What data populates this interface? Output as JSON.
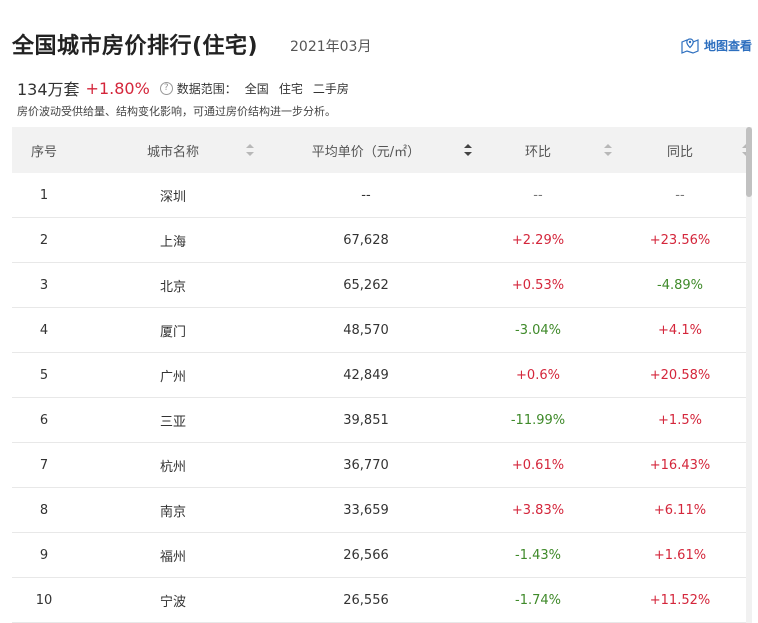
{
  "header": {
    "title": "全国城市房价排行(住宅)",
    "date": "2021年03月",
    "map_link": "地图查看"
  },
  "summary": {
    "count": "134万套",
    "change": "+1.80%",
    "scope_label": "数据范围：",
    "scope_items": [
      "全国",
      "住宅",
      "二手房"
    ],
    "note": "房价波动受供给量、结构变化影响，可通过房价结构进一步分析。"
  },
  "table": {
    "columns": [
      "序号",
      "城市名称",
      "平均单价（元/㎡）",
      "环比",
      "同比"
    ],
    "rows": [
      {
        "rank": "1",
        "city": "深圳",
        "price": "--",
        "mom": "--",
        "mom_dir": "flat",
        "yoy": "--",
        "yoy_dir": "flat"
      },
      {
        "rank": "2",
        "city": "上海",
        "price": "67,628",
        "mom": "+2.29%",
        "mom_dir": "up",
        "yoy": "+23.56%",
        "yoy_dir": "up"
      },
      {
        "rank": "3",
        "city": "北京",
        "price": "65,262",
        "mom": "+0.53%",
        "mom_dir": "up",
        "yoy": "-4.89%",
        "yoy_dir": "down"
      },
      {
        "rank": "4",
        "city": "厦门",
        "price": "48,570",
        "mom": "-3.04%",
        "mom_dir": "down",
        "yoy": "+4.1%",
        "yoy_dir": "up"
      },
      {
        "rank": "5",
        "city": "广州",
        "price": "42,849",
        "mom": "+0.6%",
        "mom_dir": "up",
        "yoy": "+20.58%",
        "yoy_dir": "up"
      },
      {
        "rank": "6",
        "city": "三亚",
        "price": "39,851",
        "mom": "-11.99%",
        "mom_dir": "down",
        "yoy": "+1.5%",
        "yoy_dir": "up"
      },
      {
        "rank": "7",
        "city": "杭州",
        "price": "36,770",
        "mom": "+0.61%",
        "mom_dir": "up",
        "yoy": "+16.43%",
        "yoy_dir": "up"
      },
      {
        "rank": "8",
        "city": "南京",
        "price": "33,659",
        "mom": "+3.83%",
        "mom_dir": "up",
        "yoy": "+6.11%",
        "yoy_dir": "up"
      },
      {
        "rank": "9",
        "city": "福州",
        "price": "26,566",
        "mom": "-1.43%",
        "mom_dir": "down",
        "yoy": "+1.61%",
        "yoy_dir": "up"
      },
      {
        "rank": "10",
        "city": "宁波",
        "price": "26,556",
        "mom": "-1.74%",
        "mom_dir": "down",
        "yoy": "+11.52%",
        "yoy_dir": "up"
      }
    ]
  },
  "colors": {
    "up": "#d4263b",
    "down": "#3f8a2a",
    "link": "#2d6fbf",
    "header_bg": "#f2f2f2"
  }
}
